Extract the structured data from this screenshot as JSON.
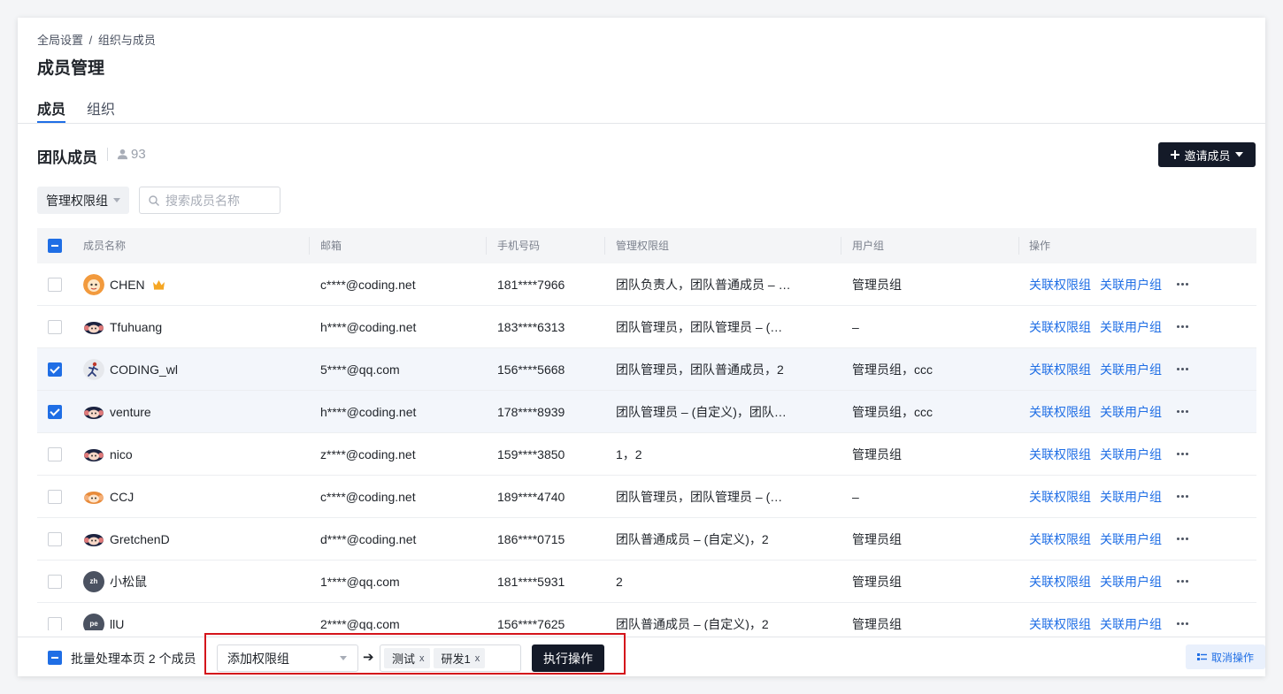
{
  "breadcrumb": {
    "root": "全局设置",
    "separator": "/",
    "current": "组织与成员"
  },
  "page_title": "成员管理",
  "tabs": [
    {
      "label": "成员",
      "active": true
    },
    {
      "label": "组织",
      "active": false
    }
  ],
  "section": {
    "title": "团队成员",
    "member_count": "93",
    "invite_label": "邀请成员"
  },
  "filters": {
    "permission_group_label": "管理权限组",
    "search_placeholder": "搜索成员名称"
  },
  "table": {
    "columns": [
      "成员名称",
      "邮箱",
      "手机号码",
      "管理权限组",
      "用户组",
      "操作"
    ],
    "rows": [
      {
        "name": "CHEN",
        "email": "c****@coding.net",
        "phone": "181****7966",
        "perm": "团队负责人，团队普通成员 – (自定义)",
        "group": "管理员组",
        "checked": false,
        "owner": true,
        "avatar": "orange-face"
      },
      {
        "name": "Tfuhuang",
        "email": "h****@coding.net",
        "phone": "183****6313",
        "perm": "团队管理员，团队管理员 – (自定义)",
        "group": "–",
        "checked": false,
        "avatar": "monkey"
      },
      {
        "name": "CODING_wl",
        "email": "5****@qq.com",
        "phone": "156****5668",
        "perm": "团队管理员，团队普通成员，2",
        "group": "管理员组，ccc",
        "checked": true,
        "avatar": "runner"
      },
      {
        "name": "venture",
        "email": "h****@coding.net",
        "phone": "178****8939",
        "perm": "团队管理员 – (自定义)，团队普通成员",
        "group": "管理员组，ccc",
        "checked": true,
        "avatar": "monkey"
      },
      {
        "name": "nico",
        "email": "z****@coding.net",
        "phone": "159****3850",
        "perm": "1，2",
        "group": "管理员组",
        "checked": false,
        "avatar": "monkey"
      },
      {
        "name": "CCJ",
        "email": "c****@coding.net",
        "phone": "189****4740",
        "perm": "团队管理员，团队管理员 – (自定义)",
        "group": "–",
        "checked": false,
        "avatar": "monkey-orange"
      },
      {
        "name": "GretchenD",
        "email": "d****@coding.net",
        "phone": "186****0715",
        "perm": "团队普通成员 – (自定义)，2",
        "group": "管理员组",
        "checked": false,
        "avatar": "monkey"
      },
      {
        "name": "小松鼠",
        "email": "1****@qq.com",
        "phone": "181****5931",
        "perm": "2",
        "group": "管理员组",
        "checked": false,
        "avatar": "initials",
        "initials": "zh"
      },
      {
        "name": "llU",
        "email": "2****@qq.com",
        "phone": "156****7625",
        "perm": "团队普通成员 – (自定义)，2",
        "group": "管理员组",
        "checked": false,
        "avatar": "initials",
        "initials": "pe"
      }
    ],
    "action_perm": "关联权限组",
    "action_group": "关联用户组"
  },
  "footer": {
    "batch_label": "批量处理本页 2 个成员",
    "action_value": "添加权限组",
    "tags": [
      "测试",
      "研发1"
    ],
    "tag_remove": "x",
    "execute_label": "执行操作",
    "cancel_label": "取消操作"
  },
  "colors": {
    "primary": "#1f6ee5",
    "dark_button": "#141a28",
    "highlight": "#d4141b"
  }
}
